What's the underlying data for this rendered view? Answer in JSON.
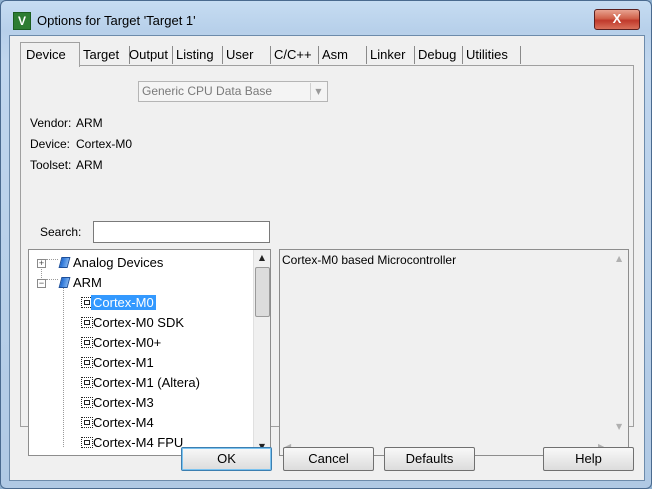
{
  "window": {
    "title": "Options for Target 'Target 1'",
    "icon_letter": "V",
    "close_glyph": "X"
  },
  "tabs": [
    "Device",
    "Target",
    "Output",
    "Listing",
    "User",
    "C/C++",
    "Asm",
    "Linker",
    "Debug",
    "Utilities"
  ],
  "active_tab": "Device",
  "database_combo": {
    "value": "Generic CPU Data Base"
  },
  "info": {
    "vendor_label": "Vendor:",
    "vendor_value": "ARM",
    "device_label": "Device:",
    "device_value": "Cortex-M0",
    "toolset_label": "Toolset:",
    "toolset_value": "ARM"
  },
  "search": {
    "label": "Search:",
    "value": ""
  },
  "tree": {
    "groups": [
      {
        "label": "Analog Devices",
        "expander": "+"
      },
      {
        "label": "ARM",
        "expander": "−"
      }
    ],
    "devices": [
      "Cortex-M0",
      "Cortex-M0 SDK",
      "Cortex-M0+",
      "Cortex-M1",
      "Cortex-M1 (Altera)",
      "Cortex-M3",
      "Cortex-M4",
      "Cortex-M4 FPU"
    ],
    "selected": "Cortex-M0"
  },
  "description": {
    "text": "Cortex-M0 based Microcontroller"
  },
  "buttons": {
    "ok": "OK",
    "cancel": "Cancel",
    "defaults": "Defaults",
    "help": "Help"
  },
  "colors": {
    "selection": "#3399ff",
    "title_bar": "#b7d0ea",
    "close_button": "#c0392b"
  }
}
